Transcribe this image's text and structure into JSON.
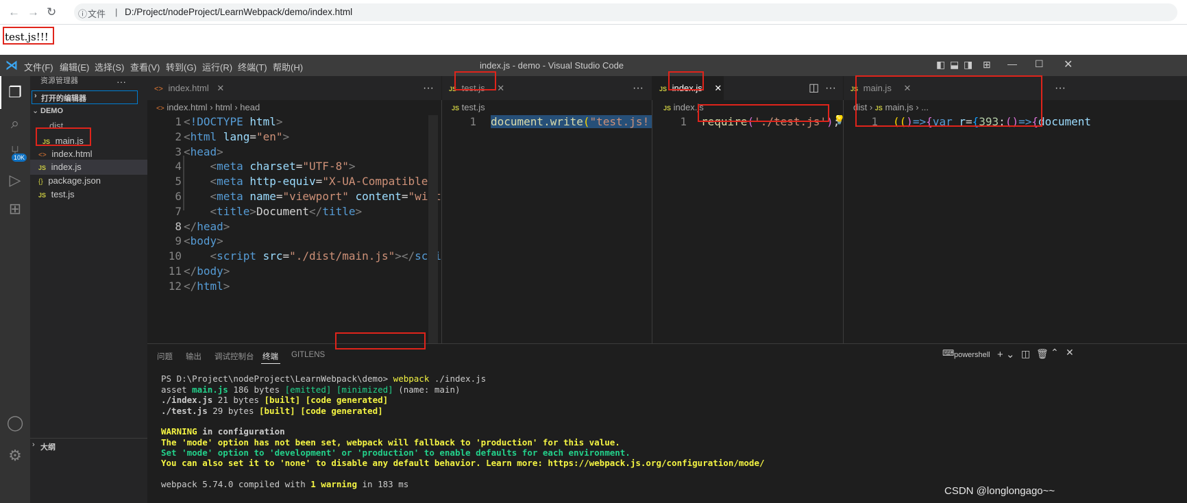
{
  "browser": {
    "address_prefix": "文件",
    "url": "D:/Project/nodeProject/LearnWebpack/demo/index.html",
    "page_text": "test.js!!!"
  },
  "vscode": {
    "window_title": "index.js - demo - Visual Studio Code",
    "menu": [
      "文件(F)",
      "编辑(E)",
      "选择(S)",
      "查看(V)",
      "转到(G)",
      "运行(R)",
      "终端(T)",
      "帮助(H)"
    ],
    "activity_badge": "10K",
    "sidebar": {
      "title": "资源管理器",
      "open_editors": "打开的编辑器",
      "root": "DEMO",
      "folder": "dist",
      "files": [
        {
          "name": "main.js",
          "type": "JS"
        },
        {
          "name": "index.html",
          "type": "<>"
        },
        {
          "name": "index.js",
          "type": "JS"
        },
        {
          "name": "package.json",
          "type": "{}"
        },
        {
          "name": "test.js",
          "type": "JS"
        }
      ],
      "outline": "大纲"
    },
    "groups": {
      "g1": {
        "tab": "index.html",
        "crumbs": [
          "index.html",
          "html",
          "head"
        ]
      },
      "g2": {
        "tab": "test.js",
        "crumbs": [
          "test.js"
        ],
        "line": "1",
        "code": "document.write(\"test.js!!!"
      },
      "g3": {
        "tab": "index.js",
        "crumbs": [
          "index.js"
        ],
        "line": "1",
        "code": "require('./test.js');"
      },
      "g4": {
        "tab": "main.js",
        "crumbs": [
          "dist",
          "main.js",
          "..."
        ],
        "line": "1",
        "code": "(()=>{var r={393:()=>{document"
      }
    },
    "html_lines": [
      "1",
      "2",
      "3",
      "4",
      "5",
      "6",
      "7",
      "8",
      "9",
      "10",
      "11",
      "12"
    ],
    "panel": {
      "tabs": [
        "问题",
        "输出",
        "调试控制台",
        "终端",
        "GITLENS"
      ],
      "shell": "powershell",
      "prompt": "PS D:\\Project\\nodeProject\\LearnWebpack\\demo>",
      "cmd": "webpack",
      "cmd_arg": " ./index.js",
      "l2a": "asset ",
      "l2b": "main.js",
      "l2c": " 186 bytes ",
      "l2d": "[emitted]",
      "l2e": " [minimized]",
      "l2f": " (name: main)",
      "l3a": "./index.js",
      "l3b": " 21 bytes ",
      "l3c": "[built] [code generated]",
      "l4a": "./test.js",
      "l4b": " 29 bytes ",
      "l4c": "[built] [code generated]",
      "l5a": "WARNING",
      "l5b": " in configuration",
      "l6": "The 'mode' option has not been set, webpack will fallback to 'production' for this value.",
      "l7": "Set 'mode' option to 'development' or 'production' to enable defaults for each environment.",
      "l8": "You can also set it to 'none' to disable any default behavior. Learn more: https://webpack.js.org/configuration/mode/",
      "l9a": "webpack 5.74.0 compiled with ",
      "l9b": "1 warning",
      "l9c": " in 183 ms"
    },
    "watermark": "CSDN @longlongago~~"
  }
}
